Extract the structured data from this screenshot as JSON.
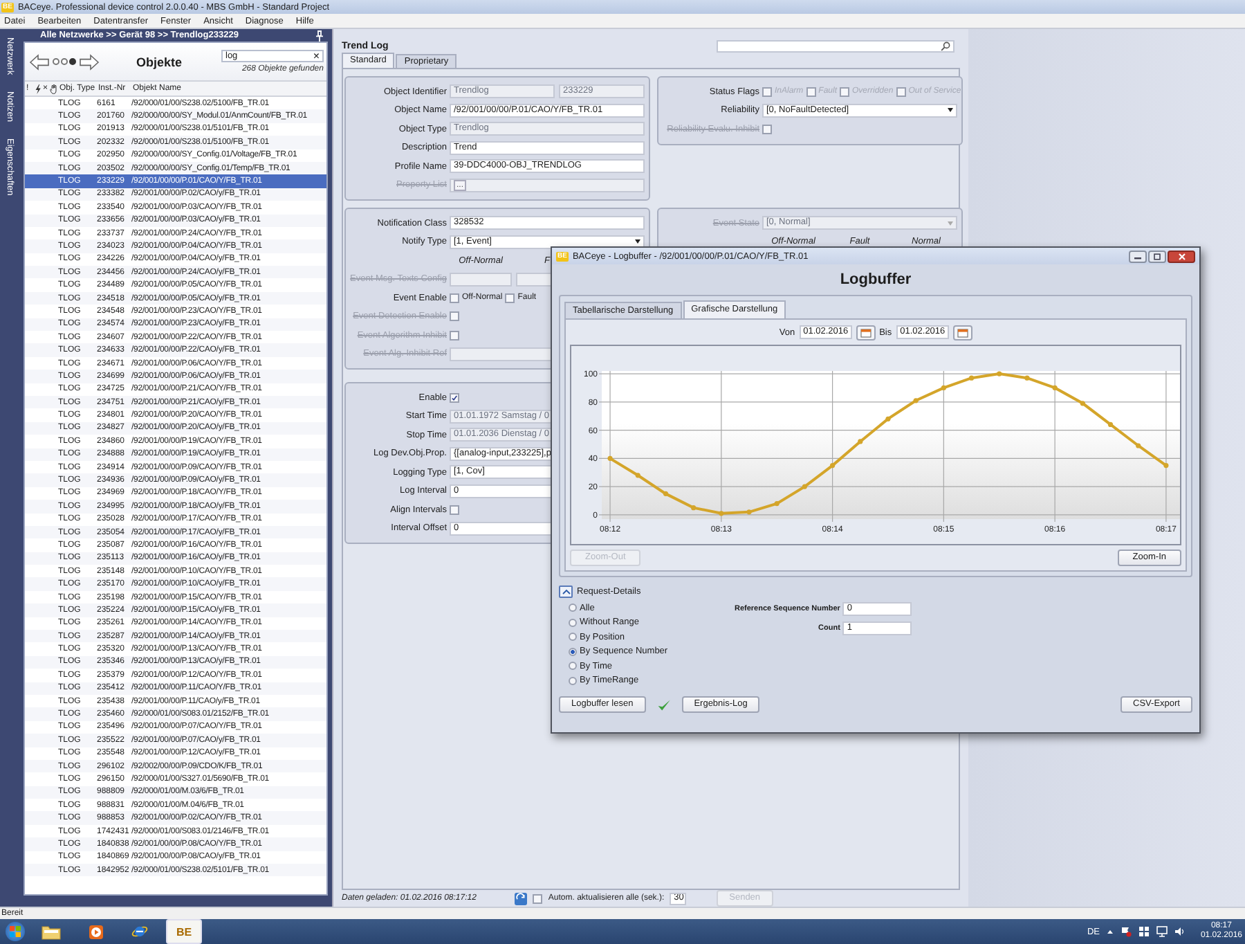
{
  "window": {
    "logo": "BE",
    "title": "BACeye. Professional device control 2.0.0.40 - MBS GmbH - Standard Project"
  },
  "menu": [
    "Datei",
    "Bearbeiten",
    "Datentransfer",
    "Fenster",
    "Ansicht",
    "Diagnose",
    "Hilfe"
  ],
  "side_tabs": [
    "Netzwerk",
    "Notizen",
    "Eigenschaften"
  ],
  "object_panel": {
    "breadcrumb": "Alle Netzwerke >> Gerät 98 >> Trendlog233229",
    "title": "Objekte",
    "pager": [
      {
        "selected": false
      },
      {
        "selected": false
      },
      {
        "selected": true
      }
    ],
    "search": {
      "value": "log",
      "clear": "×"
    },
    "found": "268 Objekte gefunden",
    "columns": [
      {
        "kind": "text",
        "label": "!"
      },
      {
        "kind": "bolt"
      },
      {
        "kind": "text",
        "label": "×"
      },
      {
        "kind": "hand"
      },
      {
        "kind": "text",
        "label": "Obj. Type"
      },
      {
        "kind": "text",
        "label": "Inst.-Nr"
      },
      {
        "kind": "text",
        "label": "Objekt Name"
      }
    ],
    "rows": [
      {
        "type": "TLOG",
        "inst": "6161",
        "name": "/92/000/01/00/S238.02/5100/FB_TR.01",
        "selected": false
      },
      {
        "type": "TLOG",
        "inst": "201760",
        "name": "/92/000/00/00/SY_Modul.01/AnmCount/FB_TR.01",
        "selected": false
      },
      {
        "type": "TLOG",
        "inst": "201913",
        "name": "/92/000/01/00/S238.01/5101/FB_TR.01",
        "selected": false
      },
      {
        "type": "TLOG",
        "inst": "202332",
        "name": "/92/000/01/00/S238.01/5100/FB_TR.01",
        "selected": false
      },
      {
        "type": "TLOG",
        "inst": "202950",
        "name": "/92/000/00/00/SY_Config.01/Voltage/FB_TR.01",
        "selected": false
      },
      {
        "type": "TLOG",
        "inst": "203502",
        "name": "/92/000/00/00/SY_Config.01/Temp/FB_TR.01",
        "selected": false
      },
      {
        "type": "TLOG",
        "inst": "233229",
        "name": "/92/001/00/00/P.01/CAO/Y/FB_TR.01",
        "selected": true
      },
      {
        "type": "TLOG",
        "inst": "233382",
        "name": "/92/001/00/00/P.02/CAO/y/FB_TR.01",
        "selected": false
      },
      {
        "type": "TLOG",
        "inst": "233540",
        "name": "/92/001/00/00/P.03/CAO/Y/FB_TR.01",
        "selected": false
      },
      {
        "type": "TLOG",
        "inst": "233656",
        "name": "/92/001/00/00/P.03/CAO/y/FB_TR.01",
        "selected": false
      },
      {
        "type": "TLOG",
        "inst": "233737",
        "name": "/92/001/00/00/P.24/CAO/Y/FB_TR.01",
        "selected": false
      },
      {
        "type": "TLOG",
        "inst": "234023",
        "name": "/92/001/00/00/P.04/CAO/Y/FB_TR.01",
        "selected": false
      },
      {
        "type": "TLOG",
        "inst": "234226",
        "name": "/92/001/00/00/P.04/CAO/y/FB_TR.01",
        "selected": false
      },
      {
        "type": "TLOG",
        "inst": "234456",
        "name": "/92/001/00/00/P.24/CAO/y/FB_TR.01",
        "selected": false
      },
      {
        "type": "TLOG",
        "inst": "234489",
        "name": "/92/001/00/00/P.05/CAO/Y/FB_TR.01",
        "selected": false
      },
      {
        "type": "TLOG",
        "inst": "234518",
        "name": "/92/001/00/00/P.05/CAO/y/FB_TR.01",
        "selected": false
      },
      {
        "type": "TLOG",
        "inst": "234548",
        "name": "/92/001/00/00/P.23/CAO/Y/FB_TR.01",
        "selected": false
      },
      {
        "type": "TLOG",
        "inst": "234574",
        "name": "/92/001/00/00/P.23/CAO/y/FB_TR.01",
        "selected": false
      },
      {
        "type": "TLOG",
        "inst": "234607",
        "name": "/92/001/00/00/P.22/CAO/Y/FB_TR.01",
        "selected": false
      },
      {
        "type": "TLOG",
        "inst": "234633",
        "name": "/92/001/00/00/P.22/CAO/y/FB_TR.01",
        "selected": false
      },
      {
        "type": "TLOG",
        "inst": "234671",
        "name": "/92/001/00/00/P.06/CAO/Y/FB_TR.01",
        "selected": false
      },
      {
        "type": "TLOG",
        "inst": "234699",
        "name": "/92/001/00/00/P.06/CAO/y/FB_TR.01",
        "selected": false
      },
      {
        "type": "TLOG",
        "inst": "234725",
        "name": "/92/001/00/00/P.21/CAO/Y/FB_TR.01",
        "selected": false
      },
      {
        "type": "TLOG",
        "inst": "234751",
        "name": "/92/001/00/00/P.21/CAO/y/FB_TR.01",
        "selected": false
      },
      {
        "type": "TLOG",
        "inst": "234801",
        "name": "/92/001/00/00/P.20/CAO/Y/FB_TR.01",
        "selected": false
      },
      {
        "type": "TLOG",
        "inst": "234827",
        "name": "/92/001/00/00/P.20/CAO/y/FB_TR.01",
        "selected": false
      },
      {
        "type": "TLOG",
        "inst": "234860",
        "name": "/92/001/00/00/P.19/CAO/Y/FB_TR.01",
        "selected": false
      },
      {
        "type": "TLOG",
        "inst": "234888",
        "name": "/92/001/00/00/P.19/CAO/y/FB_TR.01",
        "selected": false
      },
      {
        "type": "TLOG",
        "inst": "234914",
        "name": "/92/001/00/00/P.09/CAO/Y/FB_TR.01",
        "selected": false
      },
      {
        "type": "TLOG",
        "inst": "234936",
        "name": "/92/001/00/00/P.09/CAO/y/FB_TR.01",
        "selected": false
      },
      {
        "type": "TLOG",
        "inst": "234969",
        "name": "/92/001/00/00/P.18/CAO/Y/FB_TR.01",
        "selected": false
      },
      {
        "type": "TLOG",
        "inst": "234995",
        "name": "/92/001/00/00/P.18/CAO/y/FB_TR.01",
        "selected": false
      },
      {
        "type": "TLOG",
        "inst": "235028",
        "name": "/92/001/00/00/P.17/CAO/Y/FB_TR.01",
        "selected": false
      },
      {
        "type": "TLOG",
        "inst": "235054",
        "name": "/92/001/00/00/P.17/CAO/y/FB_TR.01",
        "selected": false
      },
      {
        "type": "TLOG",
        "inst": "235087",
        "name": "/92/001/00/00/P.16/CAO/Y/FB_TR.01",
        "selected": false
      },
      {
        "type": "TLOG",
        "inst": "235113",
        "name": "/92/001/00/00/P.16/CAO/y/FB_TR.01",
        "selected": false
      },
      {
        "type": "TLOG",
        "inst": "235148",
        "name": "/92/001/00/00/P.10/CAO/Y/FB_TR.01",
        "selected": false
      },
      {
        "type": "TLOG",
        "inst": "235170",
        "name": "/92/001/00/00/P.10/CAO/y/FB_TR.01",
        "selected": false
      },
      {
        "type": "TLOG",
        "inst": "235198",
        "name": "/92/001/00/00/P.15/CAO/Y/FB_TR.01",
        "selected": false
      },
      {
        "type": "TLOG",
        "inst": "235224",
        "name": "/92/001/00/00/P.15/CAO/y/FB_TR.01",
        "selected": false
      },
      {
        "type": "TLOG",
        "inst": "235261",
        "name": "/92/001/00/00/P.14/CAO/Y/FB_TR.01",
        "selected": false
      },
      {
        "type": "TLOG",
        "inst": "235287",
        "name": "/92/001/00/00/P.14/CAO/y/FB_TR.01",
        "selected": false
      },
      {
        "type": "TLOG",
        "inst": "235320",
        "name": "/92/001/00/00/P.13/CAO/Y/FB_TR.01",
        "selected": false
      },
      {
        "type": "TLOG",
        "inst": "235346",
        "name": "/92/001/00/00/P.13/CAO/y/FB_TR.01",
        "selected": false
      },
      {
        "type": "TLOG",
        "inst": "235379",
        "name": "/92/001/00/00/P.12/CAO/Y/FB_TR.01",
        "selected": false
      },
      {
        "type": "TLOG",
        "inst": "235412",
        "name": "/92/001/00/00/P.11/CAO/Y/FB_TR.01",
        "selected": false
      },
      {
        "type": "TLOG",
        "inst": "235438",
        "name": "/92/001/00/00/P.11/CAO/y/FB_TR.01",
        "selected": false
      },
      {
        "type": "TLOG",
        "inst": "235460",
        "name": "/92/000/01/00/S083.01/2152/FB_TR.01",
        "selected": false
      },
      {
        "type": "TLOG",
        "inst": "235496",
        "name": "/92/001/00/00/P.07/CAO/Y/FB_TR.01",
        "selected": false
      },
      {
        "type": "TLOG",
        "inst": "235522",
        "name": "/92/001/00/00/P.07/CAO/y/FB_TR.01",
        "selected": false
      },
      {
        "type": "TLOG",
        "inst": "235548",
        "name": "/92/001/00/00/P.12/CAO/y/FB_TR.01",
        "selected": false
      },
      {
        "type": "TLOG",
        "inst": "296102",
        "name": "/92/002/00/00/P.09/CDO/K/FB_TR.01",
        "selected": false
      },
      {
        "type": "TLOG",
        "inst": "296150",
        "name": "/92/000/01/00/S327.01/5690/FB_TR.01",
        "selected": false
      },
      {
        "type": "TLOG",
        "inst": "988809",
        "name": "/92/000/01/00/M.03/6/FB_TR.01",
        "selected": false
      },
      {
        "type": "TLOG",
        "inst": "988831",
        "name": "/92/000/01/00/M.04/6/FB_TR.01",
        "selected": false
      },
      {
        "type": "TLOG",
        "inst": "988853",
        "name": "/92/001/00/00/P.02/CAO/Y/FB_TR.01",
        "selected": false
      },
      {
        "type": "TLOG",
        "inst": "1742431",
        "name": "/92/000/01/00/S083.01/2146/FB_TR.01",
        "selected": false
      },
      {
        "type": "TLOG",
        "inst": "1840838",
        "name": "/92/001/00/00/P.08/CAO/Y/FB_TR.01",
        "selected": false
      },
      {
        "type": "TLOG",
        "inst": "1840869",
        "name": "/92/001/00/00/P.08/CAO/y/FB_TR.01",
        "selected": false
      },
      {
        "type": "TLOG",
        "inst": "1842952",
        "name": "/92/000/01/00/S238.02/5101/FB_TR.01",
        "selected": false
      }
    ]
  },
  "editor": {
    "title": "Trend Log",
    "tabs": [
      {
        "label": "Standard",
        "selected": true
      },
      {
        "label": "Proprietary",
        "selected": false
      }
    ],
    "groups": [
      {
        "rows": [
          {
            "kind": "pair",
            "label": "Object Identifier",
            "values": [
              "Trendlog",
              "233229"
            ],
            "readonly": true
          },
          {
            "kind": "input",
            "label": "Object Name",
            "value": "/92/001/00/00/P.01/CAO/Y/FB_TR.01"
          },
          {
            "kind": "input",
            "label": "Object Type",
            "value": "Trendlog",
            "readonly": true
          },
          {
            "kind": "input",
            "label": "Description",
            "value": "Trend"
          },
          {
            "kind": "input",
            "label": "Profile Name",
            "value": "39-DDC4000-OBJ_TRENDLOG"
          },
          {
            "kind": "browse",
            "label": "Property List",
            "disabled": true,
            "button": "..."
          }
        ]
      },
      {
        "rows": [
          {
            "kind": "checks",
            "label": "Status Flags",
            "options": [
              {
                "label": "InAlarm",
                "checked": false,
                "disabled": true
              },
              {
                "label": "Fault",
                "checked": false,
                "disabled": true
              },
              {
                "label": "Overridden",
                "checked": false,
                "disabled": true
              },
              {
                "label": "Out of Service",
                "checked": false,
                "disabled": true
              }
            ]
          },
          {
            "kind": "select",
            "label": "Reliability",
            "value": "[0, NoFaultDetected]"
          },
          {
            "kind": "check",
            "label": "Reliability Evalu. Inhibit",
            "disabled": true,
            "checked": false
          }
        ]
      },
      {
        "rows": [
          {
            "kind": "input",
            "label": "Notification Class",
            "value": "328532"
          },
          {
            "kind": "select",
            "label": "Notify Type",
            "value": "[1, Event]"
          },
          {
            "kind": "headings",
            "labels": [
              "Off-Normal",
              "F"
            ]
          },
          {
            "kind": "fields",
            "label": "Event Msg. Texts Config",
            "disabled": true
          },
          {
            "kind": "checks",
            "label": "Event Enable",
            "options": [
              {
                "label": "Off-Normal",
                "checked": false,
                "disabled": false
              },
              {
                "label": "Fault",
                "checked": false,
                "disabled": false
              }
            ]
          },
          {
            "kind": "check",
            "label": "Event Detection Enable",
            "disabled": true,
            "checked": false
          },
          {
            "kind": "check",
            "label": "Event Algorithm Inhibit",
            "disabled": true,
            "checked": false
          },
          {
            "kind": "input",
            "label": "Event Alg. Inhibit Ref",
            "disabled": true
          }
        ]
      },
      {
        "rows": [
          {
            "kind": "select",
            "label": "Event State",
            "value": "[0, Normal]",
            "disabled": true
          },
          {
            "kind": "headings",
            "labels": [
              "Off-Normal",
              "Fault",
              "Normal"
            ]
          }
        ]
      },
      {
        "rows": [
          {
            "kind": "check",
            "label": "Enable",
            "checked": true
          },
          {
            "kind": "input",
            "label": "Start Time",
            "value": "01.01.1972 Samstag / 0",
            "readonly": true
          },
          {
            "kind": "input",
            "label": "Stop Time",
            "value": "01.01.2036 Dienstag / 0",
            "readonly": true
          },
          {
            "kind": "input",
            "label": "Log Dev.Obj.Prop.",
            "value": "{[analog-input,233225],p"
          },
          {
            "kind": "input",
            "label": "Logging Type",
            "value": "[1, Cov]"
          },
          {
            "kind": "input",
            "label": "Log Interval",
            "value": "0"
          },
          {
            "kind": "check",
            "label": "Align Intervals",
            "checked": false
          },
          {
            "kind": "input",
            "label": "Interval Offset",
            "value": "0"
          }
        ]
      }
    ],
    "footer": {
      "loaded": "Daten geladen: 01.02.2016 08:17:12",
      "auto_label": "Autom. aktualisieren alle (sek.):",
      "auto_checked": false,
      "interval": "30",
      "send": "Senden",
      "send_disabled": true
    }
  },
  "logbuffer": {
    "logo": "BE",
    "title": "BACeye - Logbuffer - /92/001/00/00/P.01/CAO/Y/FB_TR.01",
    "heading": "Logbuffer",
    "tabs": [
      {
        "label": "Tabellarische Darstellung",
        "selected": false
      },
      {
        "label": "Grafische Darstellung",
        "selected": true
      }
    ],
    "from_label": "Von",
    "from": "01.02.2016",
    "to_label": "Bis",
    "to": "01.02.2016",
    "chart_data": {
      "type": "line",
      "categories": [
        "08:12",
        null,
        null,
        null,
        "08:13",
        null,
        null,
        null,
        "08:14",
        null,
        null,
        null,
        "08:15",
        null,
        null,
        null,
        "08:16",
        null,
        null,
        null,
        "08:17"
      ],
      "series": [
        {
          "color": "#d4a52a",
          "marker": "circle",
          "values": [
            40,
            28,
            15,
            5,
            1,
            2,
            8,
            20,
            35,
            52,
            68,
            81,
            90,
            97,
            100,
            97,
            90,
            79,
            64,
            49,
            35
          ]
        }
      ],
      "grid": true,
      "ylim": [
        -3,
        102
      ],
      "yticks": [
        0,
        20,
        40,
        60,
        80,
        100
      ]
    },
    "zoom_out": {
      "label": "Zoom-Out",
      "disabled": true
    },
    "zoom_in": {
      "label": "Zoom-In",
      "disabled": false
    },
    "request_details": {
      "label": "Request-Details",
      "expanded": true
    },
    "modes": [
      {
        "label": "Alle",
        "selected": false
      },
      {
        "label": "Without Range",
        "selected": false
      },
      {
        "label": "By Position",
        "selected": false
      },
      {
        "label": "By Sequence Number",
        "selected": true
      },
      {
        "label": "By Time",
        "selected": false
      },
      {
        "label": "By TimeRange",
        "selected": false
      }
    ],
    "params": [
      {
        "label": "Reference Sequence Number",
        "value": "0"
      },
      {
        "label": "Count",
        "value": "1"
      }
    ],
    "read_button": "Logbuffer lesen",
    "success": true,
    "log_button": "Ergebnis-Log",
    "export_button": "CSV-Export"
  },
  "status_bar": "Bereit",
  "taskbar": {
    "apps": [
      {
        "kind": "folder",
        "selected": false
      },
      {
        "kind": "media",
        "selected": false
      },
      {
        "kind": "browser",
        "selected": false
      },
      {
        "kind": "app",
        "label": "BE",
        "selected": true
      }
    ],
    "language": "DE",
    "time": "08:17",
    "date": "01.02.2016"
  }
}
